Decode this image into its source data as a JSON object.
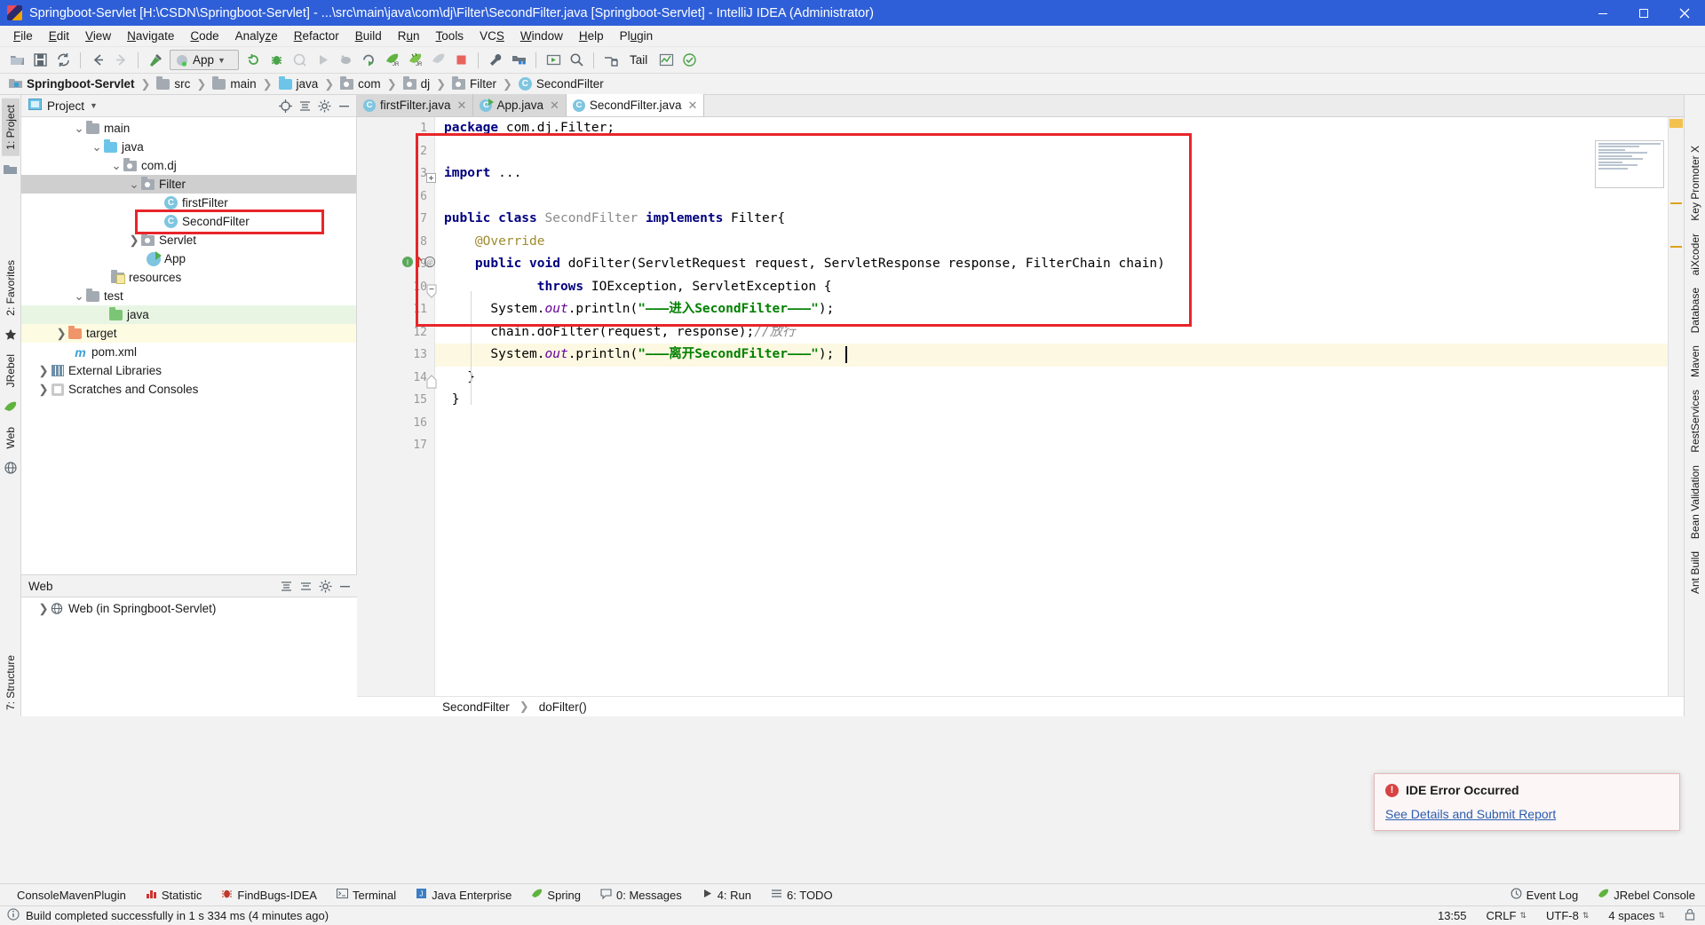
{
  "window": {
    "title": "Springboot-Servlet [H:\\CSDN\\Springboot-Servlet] - ...\\src\\main\\java\\com\\dj\\Filter\\SecondFilter.java [Springboot-Servlet] - IntelliJ IDEA (Administrator)",
    "minimize": "minimize-icon",
    "maximize": "maximize-icon",
    "close": "close-icon",
    "app_icon": "intellij-idea-icon"
  },
  "menubar": {
    "items": [
      {
        "label": "File"
      },
      {
        "label": "Edit"
      },
      {
        "label": "View"
      },
      {
        "label": "Navigate"
      },
      {
        "label": "Code"
      },
      {
        "label": "Analyze"
      },
      {
        "label": "Refactor"
      },
      {
        "label": "Build"
      },
      {
        "label": "Run"
      },
      {
        "label": "Tools"
      },
      {
        "label": "VCS"
      },
      {
        "label": "Window"
      },
      {
        "label": "Help"
      },
      {
        "label": "Plugin"
      }
    ]
  },
  "toolbar": {
    "run_config": "App",
    "tail_label": "Tail",
    "icons": [
      "open-folder-icon",
      "save-all-icon",
      "sync-icon",
      "back-arrow-icon",
      "forward-arrow-icon",
      "build-hammer-icon",
      "rerun-icon",
      "debug-icon",
      "coverage-icon",
      "run-icon",
      "attach-profiler-icon",
      "run-with-profiler-icon",
      "jrebel-run-icon",
      "jrebel-debug-icon",
      "jrebel-inactive-icon",
      "stop-icon",
      "settings-wrench-icon",
      "project-structure-icon",
      "run-anything-icon",
      "search-everywhere-icon",
      "deploy-icon",
      "chart-icon",
      "check-circle-icon"
    ]
  },
  "breadcrumb": {
    "items": [
      {
        "label": "Springboot-Servlet",
        "icon": "module-icon",
        "bold": true
      },
      {
        "label": "src",
        "icon": "folder-gray-icon",
        "bold": false
      },
      {
        "label": "main",
        "icon": "folder-gray-icon",
        "bold": false
      },
      {
        "label": "java",
        "icon": "folder-blue-icon",
        "bold": false
      },
      {
        "label": "com",
        "icon": "package-icon",
        "bold": false
      },
      {
        "label": "dj",
        "icon": "package-icon",
        "bold": false
      },
      {
        "label": "Filter",
        "icon": "package-icon",
        "bold": false
      },
      {
        "label": "SecondFilter",
        "icon": "class-icon",
        "bold": false
      }
    ]
  },
  "left_strip": {
    "tabs": [
      {
        "label": "1: Project",
        "active": true
      },
      {
        "label": "2: Favorites",
        "active": false
      },
      {
        "label": "JRebel",
        "active": false
      },
      {
        "label": "Web",
        "active": false
      },
      {
        "label": "7: Structure",
        "active": false
      }
    ],
    "icons": [
      "folder-icon",
      "star-icon",
      "jrebel-leaf-icon",
      "web-globe-icon"
    ]
  },
  "right_strip": {
    "tabs": [
      {
        "label": "Key Promoter X"
      },
      {
        "label": "aiXcoder"
      },
      {
        "label": "Database"
      },
      {
        "label": "Maven"
      },
      {
        "label": "RestServices"
      },
      {
        "label": "Bean Validation"
      },
      {
        "label": "Ant Build"
      }
    ]
  },
  "project_panel": {
    "title": "Project",
    "dropdown": "chevron-down-icon",
    "actions": [
      "locate-target-icon",
      "collapse-all-icon",
      "settings-gear-icon",
      "hide-icon"
    ],
    "tree": [
      {
        "label": "main",
        "indent": 3,
        "arrow": "down",
        "icon": "folder-gray",
        "sel": ""
      },
      {
        "label": "java",
        "indent": 4,
        "arrow": "down",
        "icon": "folder-blue",
        "sel": ""
      },
      {
        "label": "com.dj",
        "indent": 5,
        "arrow": "down",
        "icon": "package",
        "sel": ""
      },
      {
        "label": "Filter",
        "indent": 6,
        "arrow": "down",
        "icon": "package",
        "sel": "sel-gray"
      },
      {
        "label": "firstFilter",
        "indent": 7,
        "arrow": "none",
        "icon": "class",
        "sel": ""
      },
      {
        "label": "SecondFilter",
        "indent": 7,
        "arrow": "none",
        "icon": "class",
        "sel": ""
      },
      {
        "label": "Servlet",
        "indent": 6,
        "arrow": "right",
        "icon": "package",
        "sel": ""
      },
      {
        "label": "App",
        "indent": 6,
        "arrow": "none",
        "icon": "app",
        "sel": ""
      },
      {
        "label": "resources",
        "indent": 4,
        "arrow": "none",
        "icon": "resources",
        "sel": ""
      },
      {
        "label": "test",
        "indent": 3,
        "arrow": "down",
        "icon": "folder-gray",
        "sel": ""
      },
      {
        "label": "java",
        "indent": 4,
        "arrow": "none",
        "icon": "folder-green",
        "sel": "sel-green"
      },
      {
        "label": "target",
        "indent": 2,
        "arrow": "right",
        "icon": "folder-orange",
        "sel": "sel-yellow"
      },
      {
        "label": "pom.xml",
        "indent": 3,
        "arrow": "none",
        "icon": "maven-m",
        "sel": ""
      },
      {
        "label": "External Libraries",
        "indent": 1,
        "arrow": "right",
        "icon": "library",
        "sel": ""
      },
      {
        "label": "Scratches and Consoles",
        "indent": 1,
        "arrow": "right",
        "icon": "scratch",
        "sel": ""
      }
    ]
  },
  "web_panel": {
    "title": "Web",
    "actions": [
      "expand-all-icon",
      "collapse-all-icon",
      "settings-gear-icon",
      "hide-icon"
    ],
    "items": [
      {
        "label": "Web (in Springboot-Servlet)",
        "arrow": "right",
        "icon": "web-module"
      }
    ]
  },
  "editor": {
    "tabs": [
      {
        "label": "firstFilter.java",
        "icon": "class-icon",
        "active": false,
        "close": "×"
      },
      {
        "label": "App.java",
        "icon": "app-icon",
        "active": false,
        "close": "×"
      },
      {
        "label": "SecondFilter.java",
        "icon": "class-icon",
        "active": true,
        "close": "×"
      }
    ],
    "line_numbers": [
      "1",
      "2",
      "3",
      "6",
      "7",
      "8",
      "9",
      "10",
      "11",
      "12",
      "13",
      "14",
      "15",
      "16",
      "17"
    ],
    "lines": [
      {
        "n": "1",
        "html": "<span class=\"kw\">package</span> <span class=\"pl\">com.dj.Filter;</span>",
        "hl": false
      },
      {
        "n": "2",
        "html": "",
        "hl": false
      },
      {
        "n": "3",
        "html": "<span class=\"kw\">import</span> <span class=\"pl\">...</span>",
        "hl": false
      },
      {
        "n": "6",
        "html": "",
        "hl": false
      },
      {
        "n": "7",
        "html": "<span class=\"kw\">public class</span> <span class=\"cls\">SecondFilter</span> <span class=\"kw\">implements</span> <span class=\"pl\">Filter{</span>",
        "hl": false
      },
      {
        "n": "8",
        "html": "    <span class=\"anno\">@Override</span>",
        "hl": false
      },
      {
        "n": "9",
        "html": "    <span class=\"kw\">public void</span> <span class=\"pl\">doFilter(ServletRequest request, ServletResponse response, FilterChain chain)</span>",
        "hl": false
      },
      {
        "n": "10",
        "html": "            <span class=\"kw\">throws</span> <span class=\"pl\">IOException, ServletException {</span>",
        "hl": false
      },
      {
        "n": "11",
        "html": "      <span class=\"pl\">System.</span><span class=\"it\">out</span><span class=\"pl\">.println(</span><span class=\"str\">\"———进入SecondFilter———\"</span><span class=\"pl\">);</span>",
        "hl": false
      },
      {
        "n": "12",
        "html": "      <span class=\"pl\">chain.doFilter(request, response);</span><span class=\"cm\">//放行</span>",
        "hl": false
      },
      {
        "n": "13",
        "html": "      <span class=\"pl\">System.</span><span class=\"it\">out</span><span class=\"pl\">.println(</span><span class=\"str\">\"———离开SecondFilter———\"</span><span class=\"pl\">);</span>",
        "hl": true
      },
      {
        "n": "14",
        "html": "   <span class=\"pl\">}</span>",
        "hl": false
      },
      {
        "n": "15",
        "html": " <span class=\"pl\">}</span>",
        "hl": false
      },
      {
        "n": "16",
        "html": "",
        "hl": false
      },
      {
        "n": "17",
        "html": "",
        "hl": false
      }
    ],
    "footer_breadcrumb": [
      {
        "label": "SecondFilter"
      },
      {
        "label": "doFilter()"
      }
    ]
  },
  "notification": {
    "title": "IDE Error Occurred",
    "link": "See Details and Submit Report",
    "icon": "error-icon"
  },
  "tool_windows": {
    "items": [
      {
        "label": "ConsoleMavenPlugin",
        "icon": "none"
      },
      {
        "label": "Statistic",
        "icon": "statistic-icon"
      },
      {
        "label": "FindBugs-IDEA",
        "icon": "findbugs-icon"
      },
      {
        "label": "Terminal",
        "icon": "terminal-icon"
      },
      {
        "label": "Java Enterprise",
        "icon": "java-enterprise-icon"
      },
      {
        "label": "Spring",
        "icon": "spring-leaf-icon"
      },
      {
        "label": "0: Messages",
        "icon": "messages-icon"
      },
      {
        "label": "4: Run",
        "icon": "run-icon"
      },
      {
        "label": "6: TODO",
        "icon": "todo-icon"
      }
    ],
    "right_items": [
      {
        "label": "Event Log",
        "icon": "event-log-icon"
      },
      {
        "label": "JRebel Console",
        "icon": "jrebel-icon"
      }
    ]
  },
  "statusbar": {
    "message": "Build completed successfully in 1 s 334 ms (4 minutes ago)",
    "message_icon": "info-icon",
    "time": "13:55",
    "line_separator": "CRLF",
    "encoding": "UTF-8",
    "indent": "4 spaces",
    "lock_icon": "lock-icon"
  },
  "colors": {
    "titlebar": "#2f5fd8",
    "accent_red": "#e8252a",
    "link": "#2a5db0",
    "keyword": "#000080",
    "string": "#008000",
    "comment": "#8a8a8a"
  }
}
